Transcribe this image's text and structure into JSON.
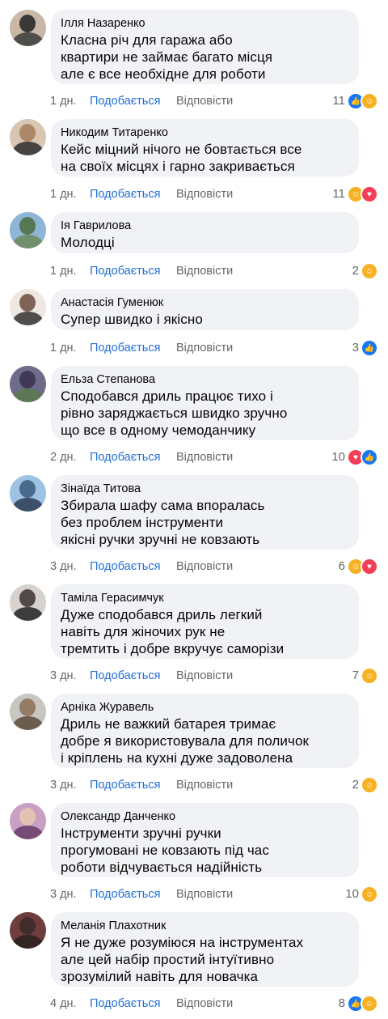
{
  "labels": {
    "like": "Подобається",
    "reply": "Відповісти"
  },
  "icons": {
    "like": "like-reaction-icon",
    "love": "love-reaction-icon",
    "care": "care-reaction-icon"
  },
  "colors": {
    "bubble": "#f0f2f5",
    "like_link": "#216fdb",
    "meta": "#65676b",
    "like_reaction": "#1877f2",
    "love_reaction": "#f33e58",
    "care_reaction": "#f7b125"
  },
  "comments": [
    {
      "author": "Ілля Назаренко",
      "text": "Класна річ для гаража або\nквартири не займає багато місця\nале є все необхідне для роботи",
      "time": "1 дн.",
      "count": "11",
      "reactions": [
        "like",
        "care"
      ]
    },
    {
      "author": "Никодим Титаренко",
      "text": "Кейс міцний нічого не бовтається все\nна своїх місцях і гарно закривається",
      "time": "1 дн.",
      "count": "11",
      "reactions": [
        "care",
        "love"
      ]
    },
    {
      "author": "Ія Гаврилова",
      "text": "Молодці",
      "time": "1 дн.",
      "count": "2",
      "reactions": [
        "care"
      ]
    },
    {
      "author": "Анастасія Гуменюк",
      "text": "Супер швидко і якісно",
      "time": "1 дн.",
      "count": "3",
      "reactions": [
        "like"
      ]
    },
    {
      "author": "Ельза Степанова",
      "text": "Сподобався дриль працює тихо і\nрівно заряджається швидко зручно\nщо все в одному чемоданчику",
      "time": "2 дн.",
      "count": "10",
      "reactions": [
        "love",
        "like"
      ]
    },
    {
      "author": "Зінаїда Титова",
      "text": "Збирала шафу сама впоралась\nбез проблем інструменти\nякісні ручки зручні не ковзають",
      "time": "3 дн.",
      "count": "6",
      "reactions": [
        "care",
        "love"
      ]
    },
    {
      "author": "Таміла Герасимчук",
      "text": "Дуже сподобався дриль легкий\nнавіть для жіночих рук не\nтремтить і добре вкручує саморізи",
      "time": "3 дн.",
      "count": "7",
      "reactions": [
        "care"
      ]
    },
    {
      "author": "Арніка Журавель",
      "text": "Дриль не важкий батарея тримає\nдобре я використовувала для поличок\nі кріплень на кухні дуже задоволена",
      "time": "3 дн.",
      "count": "2",
      "reactions": [
        "care"
      ]
    },
    {
      "author": "Олександр Данченко",
      "text": "Інструменти зручні ручки\nпрогумовані не ковзають під час\nроботи відчувається надійність",
      "time": "3 дн.",
      "count": "10",
      "reactions": [
        "care"
      ]
    },
    {
      "author": "Меланія Плахотник",
      "text": "Я не дуже розуміюся на інструментах\nале цей набір простий інтуїтивно\nзрозумілий навіть для новачка",
      "time": "4 дн.",
      "count": "8",
      "reactions": [
        "like",
        "care"
      ]
    }
  ]
}
